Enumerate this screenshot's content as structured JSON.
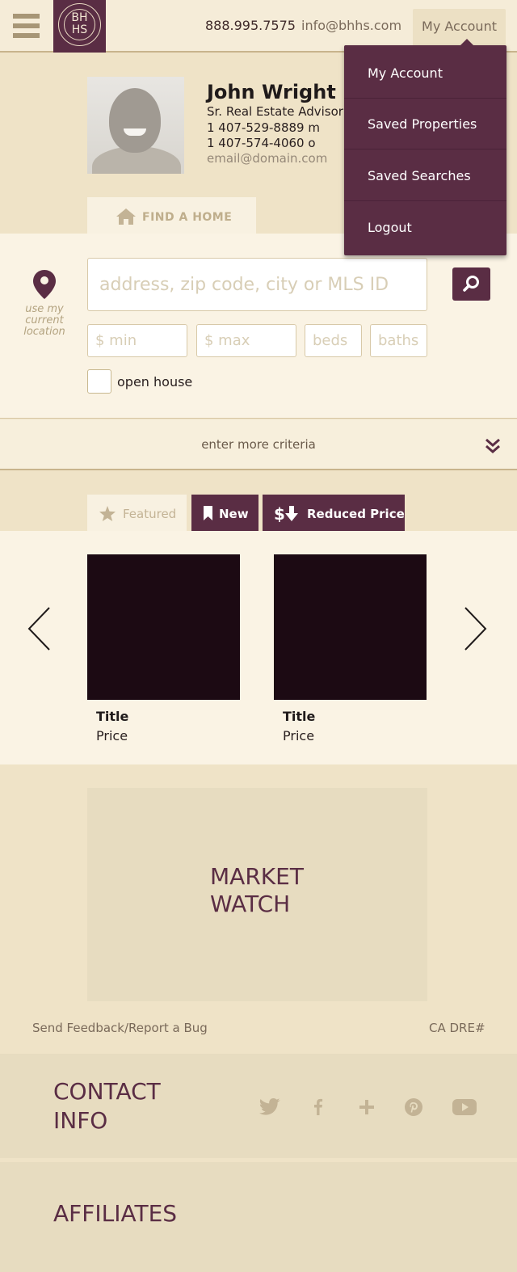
{
  "header": {
    "menu_icon": "hamburger-icon",
    "logo_text_line1": "BH",
    "logo_text_line2": "HS",
    "phone": "888.995.7575",
    "email": "info@bhhs.com",
    "account_label": "My Account"
  },
  "account_menu": {
    "items": [
      "My Account",
      "Saved Properties",
      "Saved Searches",
      "Logout"
    ]
  },
  "agent": {
    "name": "John Wright",
    "title": "Sr. Real Estate Advisor",
    "mobile": "1 407-529-8889 m",
    "office": "1 407-574-4060 o",
    "email": "email@domain.com"
  },
  "search": {
    "tab_label": "FIND A HOME",
    "location_label": "use my current location",
    "placeholder": "address, zip code, city or MLS ID",
    "min_placeholder": "$ min",
    "max_placeholder": "$ max",
    "beds_placeholder": "beds",
    "baths_placeholder": "baths",
    "open_house_label": "open house",
    "more_criteria_label": "enter more criteria"
  },
  "listing_tabs": {
    "featured": "Featured",
    "new": "New",
    "reduced": "Reduced Price"
  },
  "listings": [
    {
      "title": "Title",
      "price": "Price"
    },
    {
      "title": "Title",
      "price": "Price"
    }
  ],
  "market_watch": {
    "title": "MARKET\nWATCH"
  },
  "footer": {
    "feedback": "Send Feedback/Report a Bug",
    "license": "CA DRE#",
    "contact_title": "CONTACT\nINFO",
    "affiliates_title": "AFFILIATES",
    "social_icons": [
      "twitter-icon",
      "facebook-icon",
      "google-plus-icon",
      "pinterest-icon",
      "youtube-icon"
    ]
  },
  "colors": {
    "brand": "#5a2d44",
    "background": "#efe3c7",
    "panel": "#faf3e4",
    "muted": "#a79676"
  }
}
